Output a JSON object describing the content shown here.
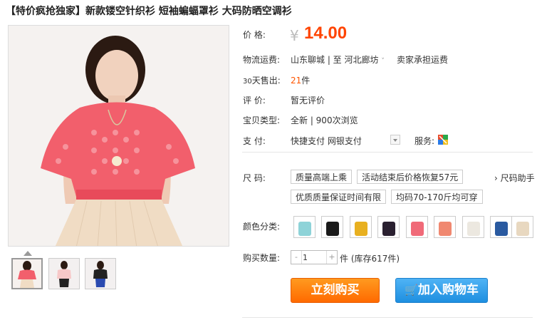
{
  "product": {
    "title": "【特价疯抢独家】新款镂空针织衫 短袖蝙蝠罩衫 大码防晒空调衫"
  },
  "price": {
    "label": "价      格:",
    "currency": "¥",
    "value": "14.00"
  },
  "shipping": {
    "label": "物流运费:",
    "route": "山东聊城 | 至  河北廊坊",
    "note": "卖家承担运费"
  },
  "sales": {
    "label_prefix": "30",
    "label_suffix": "天售出:",
    "count": "21",
    "unit": "件"
  },
  "review": {
    "label": "评      价:",
    "value": "暂无评价"
  },
  "item_type": {
    "label": "宝贝类型:",
    "value": "全新  |  900次浏览"
  },
  "payment": {
    "label": "支      付:",
    "options": "快捷支付  网银支付",
    "service_label": "服务:"
  },
  "size": {
    "label": "尺      码:",
    "options": [
      "质量高端上乘",
      "活动结束后价格恢复57元",
      "优质质量保证时间有限",
      "均码70-170斤均可穿"
    ],
    "helper": "› 尺码助手"
  },
  "color": {
    "label": "颜色分类:",
    "swatches": [
      {
        "name": "light-blue",
        "color": "#8ed3d8"
      },
      {
        "name": "black",
        "color": "#1a1a1a"
      },
      {
        "name": "yellow",
        "color": "#e8b020"
      },
      {
        "name": "dark",
        "color": "#2a2030"
      },
      {
        "name": "pink",
        "color": "#f06a78"
      },
      {
        "name": "coral",
        "color": "#f08870"
      },
      {
        "name": "white",
        "color": "#ece8e0"
      },
      {
        "name": "blue",
        "color": "#2a5aa0"
      },
      {
        "name": "beige",
        "color": "#e8d8c0"
      }
    ]
  },
  "quantity": {
    "label": "购买数量:",
    "value": "1",
    "stock": "件 (库存617件)"
  },
  "buttons": {
    "buy_now": "立刻购买",
    "add_cart": "加入购物车"
  },
  "colors": {
    "price": "#ff4400",
    "buy_button": "#ff7a00",
    "cart_button": "#2a9be8",
    "top_color": "#f25f6c"
  }
}
